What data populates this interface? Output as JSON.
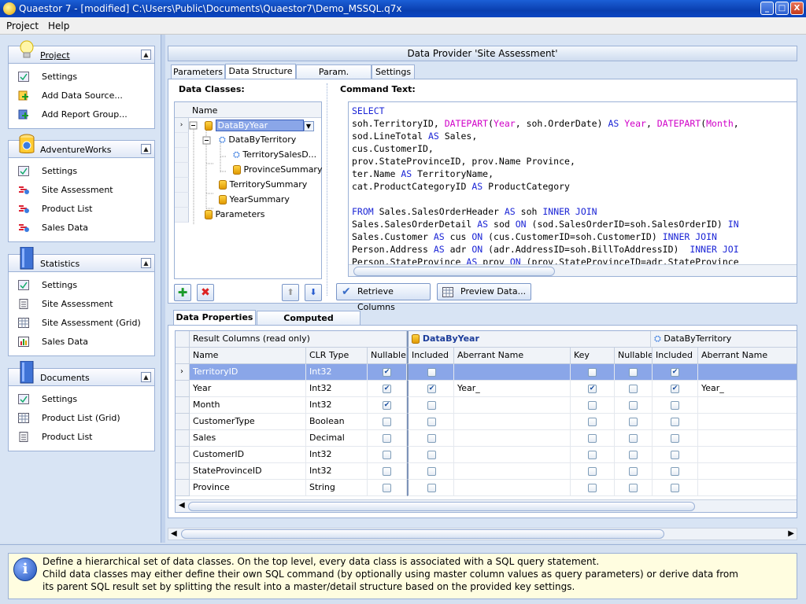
{
  "window": {
    "title": "Quaestor 7 - [modified] C:\\Users\\Public\\Documents\\Quaestor7\\Demo_MSSQL.q7x",
    "minimize": "_",
    "maximize": "□",
    "close": "X"
  },
  "menu": [
    {
      "label": "Project"
    },
    {
      "label": "Help"
    }
  ],
  "sidebar": {
    "groups": [
      {
        "title": "Project",
        "items": [
          {
            "label": "Settings"
          },
          {
            "label": "Add Data Source..."
          },
          {
            "label": "Add Report Group..."
          }
        ]
      },
      {
        "title": "AdventureWorks",
        "items": [
          {
            "label": "Settings"
          },
          {
            "label": "Site Assessment"
          },
          {
            "label": "Product List"
          },
          {
            "label": "Sales Data"
          }
        ]
      },
      {
        "title": "Statistics",
        "items": [
          {
            "label": "Settings"
          },
          {
            "label": "Site Assessment"
          },
          {
            "label": "Site Assessment (Grid)"
          },
          {
            "label": "Sales Data"
          }
        ]
      },
      {
        "title": "Documents",
        "items": [
          {
            "label": "Settings"
          },
          {
            "label": "Product List (Grid)"
          },
          {
            "label": "Product List"
          }
        ]
      }
    ]
  },
  "main": {
    "header": "Data Provider 'Site Assessment'",
    "tabs": [
      {
        "label": "Parameters"
      },
      {
        "label": "Data Structure"
      },
      {
        "label": "Param. Validation"
      },
      {
        "label": "Settings"
      }
    ],
    "data_classes": {
      "label": "Data Classes:",
      "column": "Name",
      "nodes": [
        {
          "label": "DataByYear"
        },
        {
          "label": "DataByTerritory"
        },
        {
          "label": "TerritorySalesD..."
        },
        {
          "label": "ProvinceSummary"
        },
        {
          "label": "TerritorySummary"
        },
        {
          "label": "YearSummary"
        },
        {
          "label": "Parameters"
        }
      ]
    },
    "command": {
      "label": "Command Text:",
      "lines": [
        [
          [
            "kw",
            "SELECT"
          ]
        ],
        [
          [
            "t",
            "soh.TerritoryID, "
          ],
          [
            "fn",
            "DATEPART"
          ],
          [
            "t",
            "("
          ],
          [
            "fn",
            "Year"
          ],
          [
            "t",
            ", soh.OrderDate) "
          ],
          [
            "kw",
            "AS"
          ],
          [
            "t",
            " "
          ],
          [
            "fn",
            "Year"
          ],
          [
            "t",
            ", "
          ],
          [
            "fn",
            "DATEPART"
          ],
          [
            "t",
            "("
          ],
          [
            "fn",
            "Month"
          ],
          [
            "t",
            ","
          ]
        ],
        [
          [
            "t",
            "sod.LineTotal "
          ],
          [
            "kw",
            "AS"
          ],
          [
            "t",
            " Sales,"
          ]
        ],
        [
          [
            "t",
            "cus.CustomerID,"
          ]
        ],
        [
          [
            "t",
            "prov.StateProvinceID, prov.Name Province,"
          ]
        ],
        [
          [
            "t",
            "ter.Name "
          ],
          [
            "kw",
            "AS"
          ],
          [
            "t",
            " TerritoryName,"
          ]
        ],
        [
          [
            "t",
            "cat.ProductCategoryID "
          ],
          [
            "kw",
            "AS"
          ],
          [
            "t",
            " ProductCategory"
          ]
        ],
        [
          [
            "t",
            ""
          ]
        ],
        [
          [
            "kw",
            "FROM"
          ],
          [
            "t",
            " Sales.SalesOrderHeader "
          ],
          [
            "kw",
            "AS"
          ],
          [
            "t",
            " soh "
          ],
          [
            "kw",
            "INNER JOIN"
          ]
        ],
        [
          [
            "t",
            "Sales.SalesOrderDetail "
          ],
          [
            "kw",
            "AS"
          ],
          [
            "t",
            " sod "
          ],
          [
            "kw",
            "ON"
          ],
          [
            "t",
            " (sod.SalesOrderID=soh.SalesOrderID) "
          ],
          [
            "kw",
            "IN"
          ]
        ],
        [
          [
            "t",
            "Sales.Customer "
          ],
          [
            "kw",
            "AS"
          ],
          [
            "t",
            " cus "
          ],
          [
            "kw",
            "ON"
          ],
          [
            "t",
            " (cus.CustomerID=soh.CustomerID) "
          ],
          [
            "kw",
            "INNER JOIN"
          ]
        ],
        [
          [
            "t",
            "Person.Address "
          ],
          [
            "kw",
            "AS"
          ],
          [
            "t",
            " adr "
          ],
          [
            "kw",
            "ON"
          ],
          [
            "t",
            " (adr.AddressID=soh.BillToAddressID)  "
          ],
          [
            "kw",
            "INNER JOI"
          ]
        ],
        [
          [
            "t",
            "Person.StateProvince "
          ],
          [
            "kw",
            "AS"
          ],
          [
            "t",
            " prov "
          ],
          [
            "kw",
            "ON"
          ],
          [
            "t",
            " (prov.StateProvinceID=adr.StateProvince"
          ]
        ]
      ],
      "retrieve_button": "Retrieve Columns",
      "preview_button": "Preview Data..."
    },
    "lower_tabs": [
      {
        "label": "Data Properties"
      },
      {
        "label": "Computed Properties"
      }
    ],
    "grid": {
      "result_header": "Result Columns (read only)",
      "class1": "DataByYear",
      "class2": "DataByTerritory",
      "columns": {
        "name": "Name",
        "clr": "CLR Type",
        "nullable": "Nullable",
        "included": "Included",
        "aberrant": "Aberrant Name",
        "key": "Key",
        "nullable2": "Nullable",
        "included2": "Included",
        "aberrant2": "Aberrant Name"
      },
      "rows": [
        {
          "name": "TerritoryID",
          "clr": "Int32",
          "nullable": true,
          "inc": false,
          "ab": "",
          "key": false,
          "null2": false,
          "inc2": true,
          "ab2": ""
        },
        {
          "name": "Year",
          "clr": "Int32",
          "nullable": true,
          "inc": true,
          "ab": "Year_",
          "key": true,
          "null2": false,
          "inc2": true,
          "ab2": "Year_"
        },
        {
          "name": "Month",
          "clr": "Int32",
          "nullable": true,
          "inc": false,
          "ab": "",
          "key": false,
          "null2": false,
          "inc2": false,
          "ab2": ""
        },
        {
          "name": "CustomerType",
          "clr": "Boolean",
          "nullable": false,
          "inc": false,
          "ab": "",
          "key": false,
          "null2": false,
          "inc2": false,
          "ab2": ""
        },
        {
          "name": "Sales",
          "clr": "Decimal",
          "nullable": false,
          "inc": false,
          "ab": "",
          "key": false,
          "null2": false,
          "inc2": false,
          "ab2": ""
        },
        {
          "name": "CustomerID",
          "clr": "Int32",
          "nullable": false,
          "inc": false,
          "ab": "",
          "key": false,
          "null2": false,
          "inc2": false,
          "ab2": ""
        },
        {
          "name": "StateProvinceID",
          "clr": "Int32",
          "nullable": false,
          "inc": false,
          "ab": "",
          "key": false,
          "null2": false,
          "inc2": false,
          "ab2": ""
        },
        {
          "name": "Province",
          "clr": "String",
          "nullable": false,
          "inc": false,
          "ab": "",
          "key": false,
          "null2": false,
          "inc2": false,
          "ab2": ""
        }
      ]
    }
  },
  "info": {
    "lines": [
      "Define a hierarchical set of data classes. On the top level, every data class is associated with a SQL query statement.",
      "Child data classes may either define their own SQL command (by optionally using master column values as query parameters) or derive data from",
      "its parent SQL result set by splitting the result into a master/detail structure based on the provided key settings."
    ]
  },
  "colors": {
    "selection": "#8aa6e8",
    "keyword": "#1b25d6",
    "function": "#d000c8"
  }
}
